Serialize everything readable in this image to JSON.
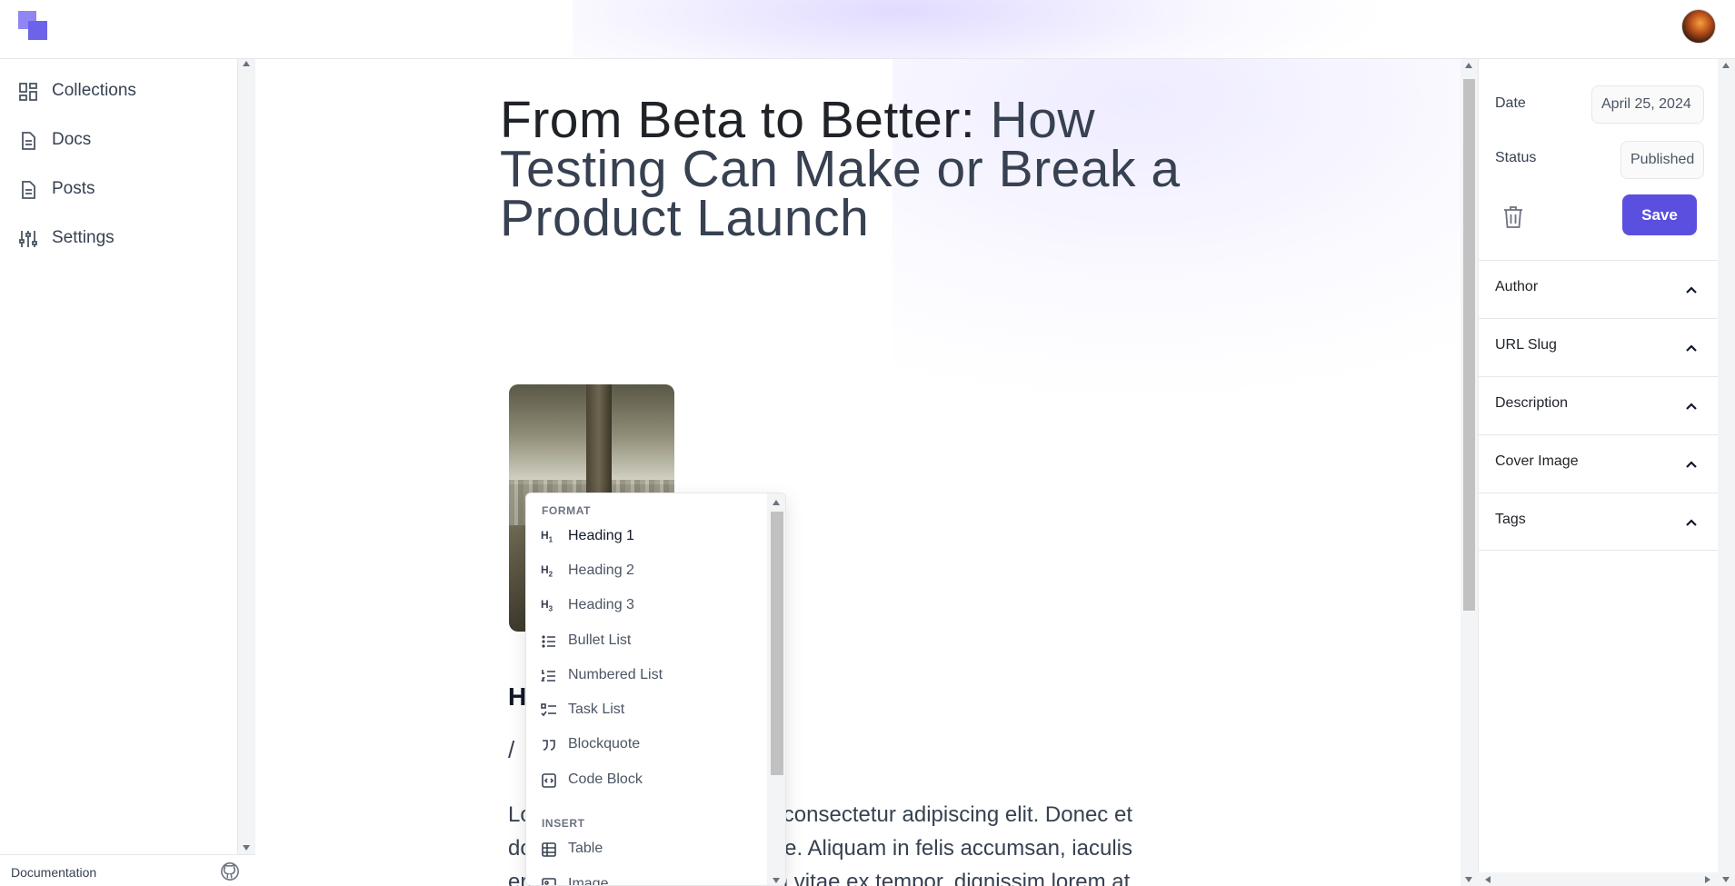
{
  "sidebar": {
    "items": [
      {
        "label": "Collections",
        "icon": "grid-icon"
      },
      {
        "label": "Docs",
        "icon": "document-icon"
      },
      {
        "label": "Posts",
        "icon": "document-icon"
      },
      {
        "label": "Settings",
        "icon": "sliders-icon"
      }
    ],
    "footer_link": "Documentation",
    "footer_icon": "github-icon"
  },
  "editor": {
    "title_part1": "From Beta to Better:",
    "title_part2": " How Testing Can Make or Break a Product Launch",
    "heading_partial": "H",
    "slash": "/",
    "paragraph": "Lorem ipsum dolor sit amet, consectetur adipiscing elit. Donec et dolor at sem tempor vulputate. Aliquam in felis accumsan, iaculis eros quis, mattis dolor. Etiam vitae ex tempor, dignissim lorem at,"
  },
  "slash_menu": {
    "format_label": "FORMAT",
    "insert_label": "INSERT",
    "format_items": [
      {
        "label": "Heading 1",
        "icon": "H1",
        "active": true
      },
      {
        "label": "Heading 2",
        "icon": "H2"
      },
      {
        "label": "Heading 3",
        "icon": "H3"
      },
      {
        "label": "Bullet List",
        "icon": "bullet-list-icon"
      },
      {
        "label": "Numbered List",
        "icon": "numbered-list-icon"
      },
      {
        "label": "Task List",
        "icon": "task-list-icon"
      },
      {
        "label": "Blockquote",
        "icon": "quote-icon"
      },
      {
        "label": "Code Block",
        "icon": "code-block-icon"
      }
    ],
    "insert_items": [
      {
        "label": "Table",
        "icon": "table-icon"
      },
      {
        "label": "Image",
        "icon": "image-icon"
      }
    ]
  },
  "panel": {
    "date_label": "Date",
    "date_value": "April 25, 2024",
    "status_label": "Status",
    "status_value": "Published",
    "save_label": "Save",
    "sections": [
      "Author",
      "URL Slug",
      "Description",
      "Cover Image",
      "Tags"
    ]
  },
  "colors": {
    "accent": "#5b4fe0",
    "logo_light": "#8f86f3",
    "logo_dark": "#6d63e8"
  }
}
